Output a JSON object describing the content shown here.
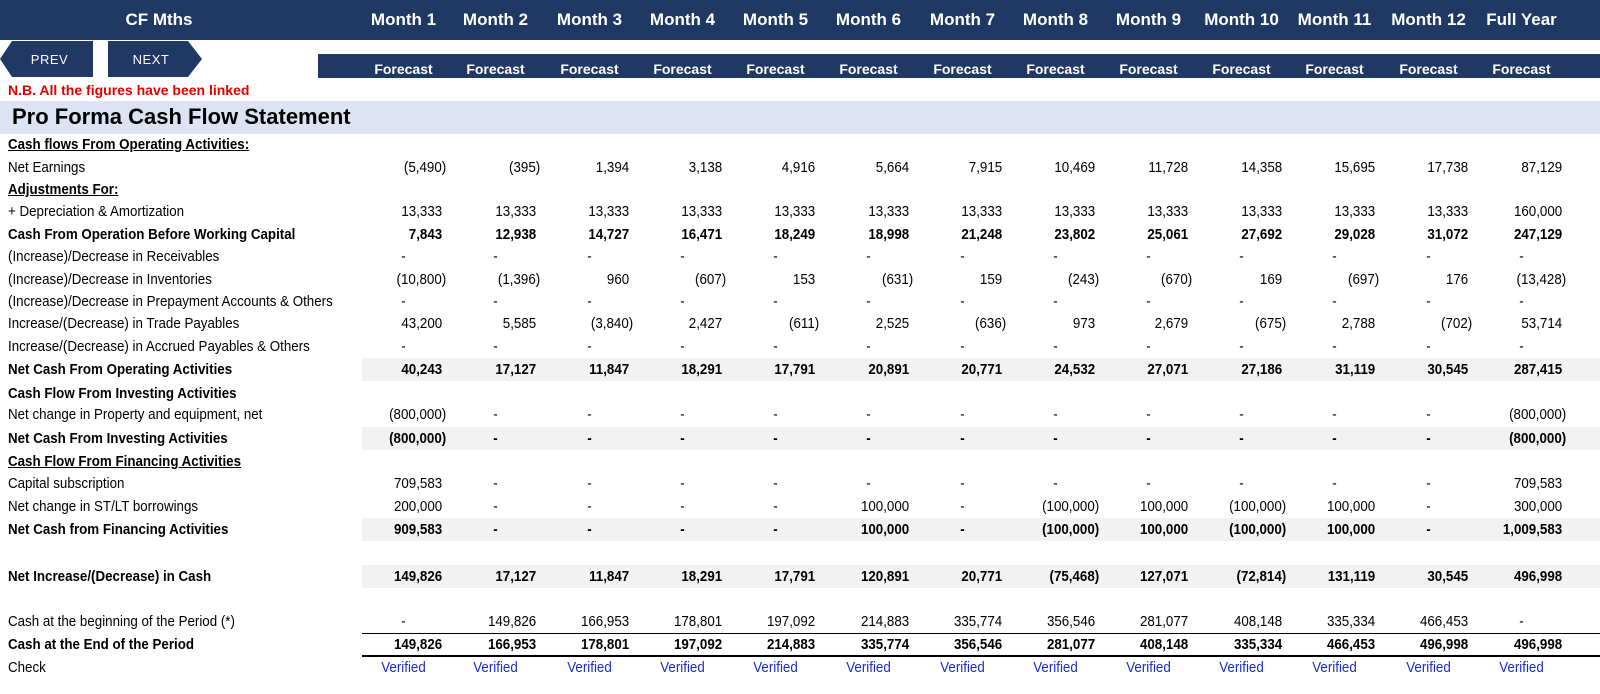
{
  "header": {
    "title": "CF Mths",
    "columns": [
      "Month 1",
      "Month 2",
      "Month 3",
      "Month 4",
      "Month 5",
      "Month 6",
      "Month 7",
      "Month 8",
      "Month 9",
      "Month 10",
      "Month 11",
      "Month 12",
      "Full Year"
    ],
    "subtitle": "Forecast"
  },
  "nav": {
    "prev_label": "PREV",
    "next_label": "NEXT"
  },
  "note": "N.B. All the figures have been linked",
  "statement_title": "Pro Forma Cash Flow Statement",
  "rows": [
    {
      "label": "Cash flows From Operating Activities:",
      "style": "bu",
      "values": []
    },
    {
      "label": "Net Earnings",
      "style": "",
      "values": [
        "(5,490)",
        "(395)",
        "1,394",
        "3,138",
        "4,916",
        "5,664",
        "7,915",
        "10,469",
        "11,728",
        "14,358",
        "15,695",
        "17,738",
        "87,129"
      ]
    },
    {
      "label": "Adjustments For:",
      "style": "bu",
      "values": []
    },
    {
      "label": " + Depreciation & Amortization",
      "style": "",
      "values": [
        "13,333",
        "13,333",
        "13,333",
        "13,333",
        "13,333",
        "13,333",
        "13,333",
        "13,333",
        "13,333",
        "13,333",
        "13,333",
        "13,333",
        "160,000"
      ]
    },
    {
      "label": "Cash From Operation Before Working Capital",
      "style": "b",
      "values": [
        "7,843",
        "12,938",
        "14,727",
        "16,471",
        "18,249",
        "18,998",
        "21,248",
        "23,802",
        "25,061",
        "27,692",
        "29,028",
        "31,072",
        "247,129"
      ]
    },
    {
      "label": "(Increase)/Decrease in Receivables",
      "style": "",
      "values": [
        "-",
        "-",
        "-",
        "-",
        "-",
        "-",
        "-",
        "-",
        "-",
        "-",
        "-",
        "-",
        "-"
      ]
    },
    {
      "label": "(Increase)/Decrease in Inventories",
      "style": "",
      "values": [
        "(10,800)",
        "(1,396)",
        "960",
        "(607)",
        "153",
        "(631)",
        "159",
        "(243)",
        "(670)",
        "169",
        "(697)",
        "176",
        "(13,428)"
      ]
    },
    {
      "label": "(Increase)/Decrease in Prepayment Accounts & Others",
      "style": "",
      "values": [
        "-",
        "-",
        "-",
        "-",
        "-",
        "-",
        "-",
        "-",
        "-",
        "-",
        "-",
        "-",
        "-"
      ]
    },
    {
      "label": "Increase/(Decrease) in Trade Payables",
      "style": "",
      "values": [
        "43,200",
        "5,585",
        "(3,840)",
        "2,427",
        "(611)",
        "2,525",
        "(636)",
        "973",
        "2,679",
        "(675)",
        "2,788",
        "(702)",
        "53,714"
      ]
    },
    {
      "label": "Increase/(Decrease) in Accrued Payables & Others",
      "style": "",
      "values": [
        "-",
        "-",
        "-",
        "-",
        "-",
        "-",
        "-",
        "-",
        "-",
        "-",
        "-",
        "-",
        "-"
      ]
    },
    {
      "label": "Net Cash From Operating Activities",
      "style": "b",
      "shade": true,
      "values": [
        "40,243",
        "17,127",
        "11,847",
        "18,291",
        "17,791",
        "20,891",
        "20,771",
        "24,532",
        "27,071",
        "27,186",
        "31,119",
        "30,545",
        "287,415"
      ]
    },
    {
      "label": "Cash Flow From Investing Activities",
      "style": "b",
      "values": []
    },
    {
      "label": "Net change in Property and equipment, net",
      "style": "",
      "values": [
        "(800,000)",
        "-",
        "-",
        "-",
        "-",
        "-",
        "-",
        "-",
        "-",
        "-",
        "-",
        "-",
        "(800,000)"
      ]
    },
    {
      "label": "Net Cash From Investing Activities",
      "style": "b",
      "shade": true,
      "values": [
        "(800,000)",
        "-",
        "-",
        "-",
        "-",
        "-",
        "-",
        "-",
        "-",
        "-",
        "-",
        "-",
        "(800,000)"
      ]
    },
    {
      "label": "Cash Flow From Financing Activities",
      "style": "bu",
      "values": []
    },
    {
      "label": "Capital subscription",
      "style": "",
      "values": [
        "709,583",
        "-",
        "-",
        "-",
        "-",
        "-",
        "-",
        "-",
        "-",
        "-",
        "-",
        "-",
        "709,583"
      ]
    },
    {
      "label": "Net change in ST/LT borrowings",
      "style": "",
      "values": [
        "200,000",
        "-",
        "-",
        "-",
        "-",
        "100,000",
        "-",
        "(100,000)",
        "100,000",
        "(100,000)",
        "100,000",
        "-",
        "300,000"
      ]
    },
    {
      "label": "Net Cash from Financing Activities",
      "style": "b",
      "shade": true,
      "values": [
        "909,583",
        "-",
        "-",
        "-",
        "-",
        "100,000",
        "-",
        "(100,000)",
        "100,000",
        "(100,000)",
        "100,000",
        "-",
        "1,009,583"
      ]
    },
    {
      "label": "Net Increase/(Decrease) in Cash",
      "style": "b",
      "shade": true,
      "gap": true,
      "values": [
        "149,826",
        "17,127",
        "11,847",
        "18,291",
        "17,791",
        "120,891",
        "20,771",
        "(75,468)",
        "127,071",
        "(72,814)",
        "131,119",
        "30,545",
        "496,998"
      ]
    },
    {
      "label": "Cash at the beginning of the Period (*)",
      "style": "",
      "gap": true,
      "values": [
        "-",
        "149,826",
        "166,953",
        "178,801",
        "197,092",
        "214,883",
        "335,774",
        "356,546",
        "281,077",
        "408,148",
        "335,334",
        "466,453",
        "-"
      ]
    },
    {
      "label": "Cash at the End of the Period",
      "style": "b",
      "ruled": true,
      "values": [
        "149,826",
        "166,953",
        "178,801",
        "197,092",
        "214,883",
        "335,774",
        "356,546",
        "281,077",
        "408,148",
        "335,334",
        "466,453",
        "496,998",
        "496,998"
      ]
    },
    {
      "label": "Check",
      "style": "",
      "check": true,
      "values": [
        "Verified",
        "Verified",
        "Verified",
        "Verified",
        "Verified",
        "Verified",
        "Verified",
        "Verified",
        "Verified",
        "Verified",
        "Verified",
        "Verified",
        "Verified"
      ]
    }
  ],
  "colors": {
    "header_bg": "#1f3864",
    "note": "#e00000",
    "title_band": "#dde3f3",
    "verified": "#1a2ec8",
    "shade": "#f2f2f2"
  }
}
